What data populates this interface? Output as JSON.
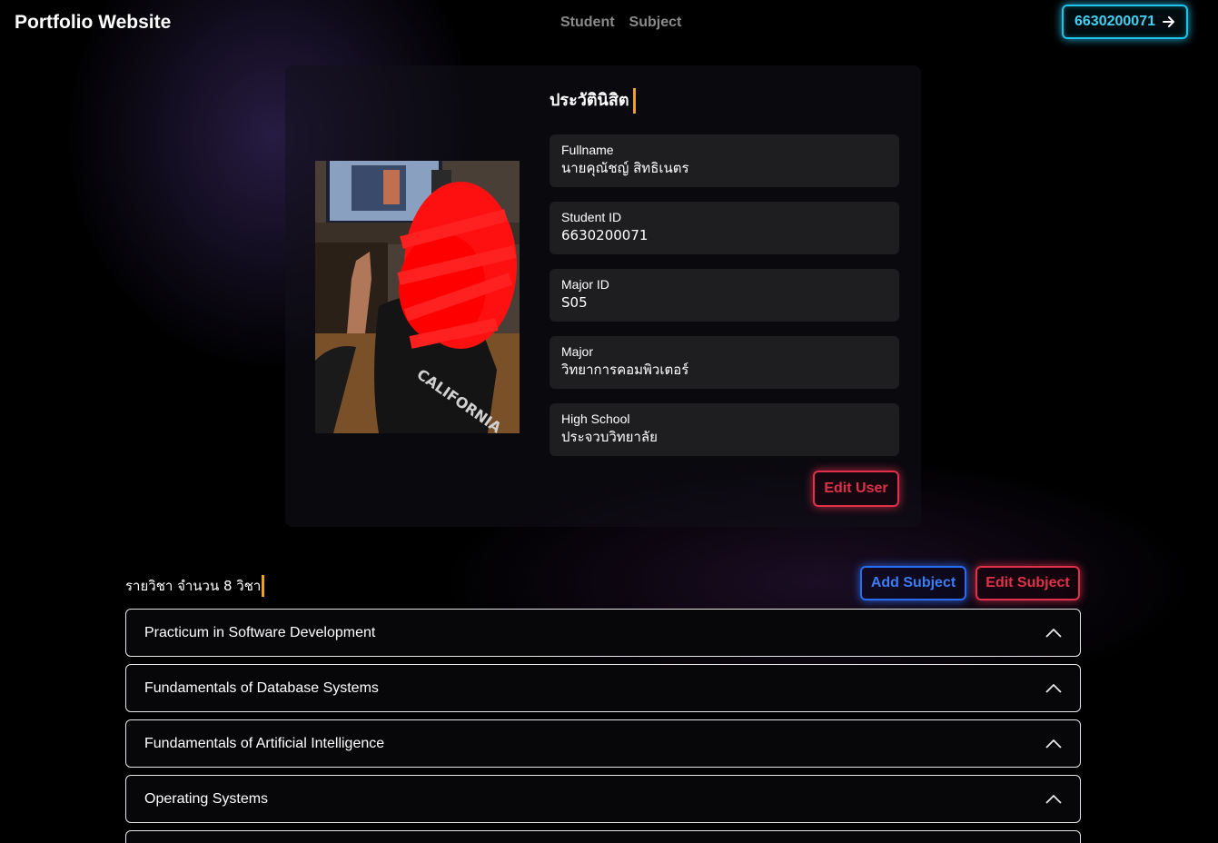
{
  "navbar": {
    "brand": "Portfolio Website",
    "links": [
      "Student",
      "Subject"
    ],
    "user_button_label": "6630200071",
    "user_button_icon": "arrow-right-icon"
  },
  "profile": {
    "section_title": "ประวัตินิสิต",
    "fields": [
      {
        "label": "Fullname",
        "value": "นายคุณัชญ์ สิทธิเนตร"
      },
      {
        "label": "Student ID",
        "value": "6630200071"
      },
      {
        "label": "Major ID",
        "value": "S05"
      },
      {
        "label": "Major",
        "value": "วิทยาการคอมพิวเตอร์"
      },
      {
        "label": "High School",
        "value": "ประจวบวิทยาลัย"
      }
    ],
    "edit_button": "Edit User"
  },
  "subjects": {
    "title": "รายวิชา จำนวน 8 วิชา",
    "add_button": "Add Subject",
    "edit_button": "Edit Subject",
    "items": [
      "Practicum in Software Development",
      "Fundamentals of Database Systems",
      "Fundamentals of Artificial Intelligence",
      "Operating Systems"
    ]
  },
  "colors": {
    "accent_cyan": "#22c3e8",
    "accent_red": "#e0304a",
    "accent_blue": "#2a6cf0",
    "cursor_orange": "#f0a020"
  }
}
